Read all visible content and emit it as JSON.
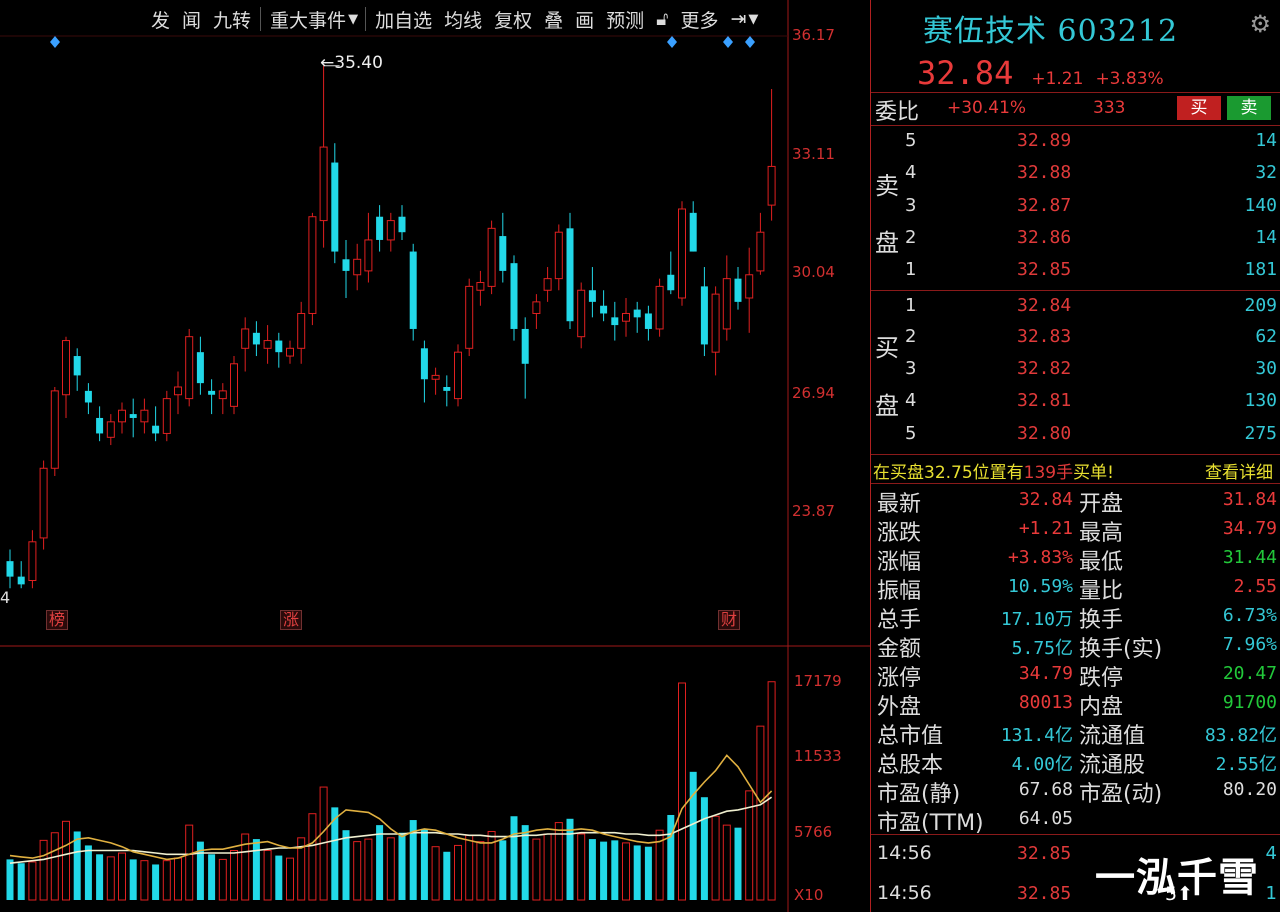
{
  "toolbar": {
    "items": [
      "发",
      "闻",
      "九转",
      "重大事件",
      "加自选",
      "均线",
      "复权",
      "叠",
      "画",
      "预测",
      "更多"
    ]
  },
  "chart_data": {
    "type": "candlestick",
    "price_axis": {
      "labels": [
        "36.17",
        "33.11",
        "30.04",
        "26.94",
        "23.87"
      ],
      "values": [
        36.17,
        33.11,
        30.04,
        26.94,
        23.87
      ]
    },
    "volume_axis": {
      "labels": [
        "17179",
        "11533",
        "5766"
      ],
      "values": [
        17179,
        11533,
        5766
      ],
      "multiplier_label": "X10"
    },
    "peak_label": "35.40",
    "low_label": "4",
    "event_tags": [
      "榜",
      "涨",
      "财"
    ],
    "colors": {
      "up": "#e02020",
      "down": "#22d8e8",
      "ma_short": "#e0b040",
      "ma_long": "#f0f0d0"
    },
    "candles": [
      {
        "o": 22.6,
        "h": 22.9,
        "l": 21.9,
        "c": 22.2
      },
      {
        "o": 22.2,
        "h": 22.6,
        "l": 21.9,
        "c": 22.0
      },
      {
        "o": 22.1,
        "h": 23.4,
        "l": 21.9,
        "c": 23.1
      },
      {
        "o": 23.2,
        "h": 25.2,
        "l": 22.9,
        "c": 25.0
      },
      {
        "o": 25.0,
        "h": 27.1,
        "l": 24.8,
        "c": 27.0
      },
      {
        "o": 26.9,
        "h": 28.4,
        "l": 26.3,
        "c": 28.3
      },
      {
        "o": 27.9,
        "h": 28.1,
        "l": 27.0,
        "c": 27.4
      },
      {
        "o": 27.0,
        "h": 27.2,
        "l": 26.4,
        "c": 26.7
      },
      {
        "o": 26.3,
        "h": 26.6,
        "l": 25.7,
        "c": 25.9
      },
      {
        "o": 25.8,
        "h": 26.4,
        "l": 25.6,
        "c": 26.2
      },
      {
        "o": 26.2,
        "h": 26.7,
        "l": 25.9,
        "c": 26.5
      },
      {
        "o": 26.4,
        "h": 26.8,
        "l": 25.8,
        "c": 26.3
      },
      {
        "o": 26.2,
        "h": 26.8,
        "l": 25.9,
        "c": 26.5
      },
      {
        "o": 26.1,
        "h": 26.6,
        "l": 25.7,
        "c": 25.9
      },
      {
        "o": 25.9,
        "h": 27.0,
        "l": 25.7,
        "c": 26.8
      },
      {
        "o": 26.9,
        "h": 27.5,
        "l": 26.4,
        "c": 27.1
      },
      {
        "o": 26.8,
        "h": 28.6,
        "l": 26.6,
        "c": 28.4
      },
      {
        "o": 28.0,
        "h": 28.4,
        "l": 26.9,
        "c": 27.2
      },
      {
        "o": 27.0,
        "h": 27.3,
        "l": 26.4,
        "c": 26.9
      },
      {
        "o": 26.8,
        "h": 27.2,
        "l": 26.4,
        "c": 27.0
      },
      {
        "o": 26.6,
        "h": 27.9,
        "l": 26.4,
        "c": 27.7
      },
      {
        "o": 28.1,
        "h": 28.9,
        "l": 27.5,
        "c": 28.6
      },
      {
        "o": 28.5,
        "h": 28.8,
        "l": 27.9,
        "c": 28.2
      },
      {
        "o": 28.1,
        "h": 28.7,
        "l": 27.7,
        "c": 28.3
      },
      {
        "o": 28.3,
        "h": 28.5,
        "l": 27.6,
        "c": 28.0
      },
      {
        "o": 27.9,
        "h": 28.3,
        "l": 27.7,
        "c": 28.1
      },
      {
        "o": 28.1,
        "h": 29.3,
        "l": 27.7,
        "c": 29.0
      },
      {
        "o": 29.0,
        "h": 31.6,
        "l": 28.7,
        "c": 31.5
      },
      {
        "o": 31.4,
        "h": 35.4,
        "l": 30.7,
        "c": 33.3
      },
      {
        "o": 32.9,
        "h": 33.4,
        "l": 30.3,
        "c": 30.6
      },
      {
        "o": 30.4,
        "h": 30.9,
        "l": 29.4,
        "c": 30.1
      },
      {
        "o": 30.0,
        "h": 30.8,
        "l": 29.6,
        "c": 30.4
      },
      {
        "o": 30.1,
        "h": 31.6,
        "l": 29.8,
        "c": 30.9
      },
      {
        "o": 31.5,
        "h": 31.8,
        "l": 30.6,
        "c": 30.9
      },
      {
        "o": 30.9,
        "h": 31.6,
        "l": 30.6,
        "c": 31.4
      },
      {
        "o": 31.5,
        "h": 31.8,
        "l": 30.9,
        "c": 31.1
      },
      {
        "o": 30.6,
        "h": 30.8,
        "l": 28.3,
        "c": 28.6
      },
      {
        "o": 28.1,
        "h": 28.3,
        "l": 26.7,
        "c": 27.3
      },
      {
        "o": 27.3,
        "h": 27.6,
        "l": 26.9,
        "c": 27.4
      },
      {
        "o": 27.1,
        "h": 27.4,
        "l": 26.6,
        "c": 27.0
      },
      {
        "o": 26.8,
        "h": 28.2,
        "l": 26.6,
        "c": 28.0
      },
      {
        "o": 28.1,
        "h": 29.9,
        "l": 27.9,
        "c": 29.7
      },
      {
        "o": 29.6,
        "h": 30.1,
        "l": 29.2,
        "c": 29.8
      },
      {
        "o": 29.7,
        "h": 31.4,
        "l": 29.5,
        "c": 31.2
      },
      {
        "o": 31.0,
        "h": 31.6,
        "l": 29.8,
        "c": 30.1
      },
      {
        "o": 30.3,
        "h": 30.5,
        "l": 28.3,
        "c": 28.6
      },
      {
        "o": 28.6,
        "h": 28.9,
        "l": 26.8,
        "c": 27.7
      },
      {
        "o": 29.0,
        "h": 29.5,
        "l": 28.6,
        "c": 29.3
      },
      {
        "o": 29.6,
        "h": 30.2,
        "l": 29.3,
        "c": 29.9
      },
      {
        "o": 29.9,
        "h": 31.3,
        "l": 29.6,
        "c": 31.1
      },
      {
        "o": 31.2,
        "h": 31.6,
        "l": 28.6,
        "c": 28.8
      },
      {
        "o": 28.4,
        "h": 29.8,
        "l": 28.1,
        "c": 29.6
      },
      {
        "o": 29.6,
        "h": 30.2,
        "l": 28.9,
        "c": 29.3
      },
      {
        "o": 29.2,
        "h": 29.6,
        "l": 28.8,
        "c": 29.0
      },
      {
        "o": 28.9,
        "h": 29.3,
        "l": 28.3,
        "c": 28.7
      },
      {
        "o": 28.8,
        "h": 29.4,
        "l": 28.4,
        "c": 29.0
      },
      {
        "o": 29.1,
        "h": 29.3,
        "l": 28.5,
        "c": 28.9
      },
      {
        "o": 29.0,
        "h": 29.2,
        "l": 28.3,
        "c": 28.6
      },
      {
        "o": 28.6,
        "h": 29.9,
        "l": 28.4,
        "c": 29.7
      },
      {
        "o": 30.0,
        "h": 30.6,
        "l": 29.5,
        "c": 29.6
      },
      {
        "o": 29.4,
        "h": 31.9,
        "l": 29.2,
        "c": 31.7
      },
      {
        "o": 31.6,
        "h": 31.9,
        "l": 30.6,
        "c": 30.6
      },
      {
        "o": 29.7,
        "h": 30.2,
        "l": 27.9,
        "c": 28.2
      },
      {
        "o": 28.0,
        "h": 29.7,
        "l": 27.4,
        "c": 29.5
      },
      {
        "o": 28.6,
        "h": 30.5,
        "l": 28.3,
        "c": 29.9
      },
      {
        "o": 29.9,
        "h": 30.2,
        "l": 29.1,
        "c": 29.3
      },
      {
        "o": 29.4,
        "h": 30.7,
        "l": 28.5,
        "c": 30.0
      },
      {
        "o": 30.1,
        "h": 31.6,
        "l": 30.0,
        "c": 31.1
      },
      {
        "o": 31.8,
        "h": 34.8,
        "l": 31.4,
        "c": 32.8
      }
    ],
    "volumes": [
      3200,
      2900,
      3000,
      4700,
      5300,
      6200,
      5400,
      4300,
      3600,
      3400,
      3700,
      3200,
      3100,
      2800,
      3100,
      3300,
      5900,
      4600,
      3600,
      3200,
      3900,
      5200,
      4800,
      3900,
      3500,
      3300,
      4900,
      6800,
      8900,
      7300,
      5500,
      4600,
      4800,
      5900,
      4900,
      5300,
      6300,
      5600,
      4200,
      3800,
      4300,
      5100,
      4600,
      5400,
      4700,
      6600,
      5900,
      4800,
      5200,
      6100,
      6400,
      5200,
      4800,
      4600,
      4700,
      4500,
      4300,
      4200,
      5500,
      6700,
      17100,
      10100,
      8100,
      6600,
      5900,
      5700,
      8600,
      13700,
      17200
    ],
    "ma_short": [
      3500,
      3400,
      3300,
      3500,
      3900,
      4300,
      4800,
      4900,
      4700,
      4500,
      4200,
      3800,
      3600,
      3400,
      3200,
      3300,
      3600,
      3900,
      4000,
      4000,
      4200,
      4400,
      4500,
      4600,
      4300,
      4100,
      4100,
      4500,
      5400,
      6400,
      7100,
      7000,
      6900,
      6400,
      5600,
      5000,
      5400,
      5600,
      5500,
      5200,
      4900,
      4700,
      4500,
      4500,
      4800,
      5200,
      5300,
      5500,
      5600,
      5500,
      5500,
      5600,
      5500,
      5200,
      5000,
      4800,
      4600,
      4500,
      4600,
      5000,
      7200,
      8300,
      9300,
      10200,
      11400,
      10500,
      9100,
      7700,
      8600
    ],
    "ma_long": [
      2900,
      3000,
      3100,
      3200,
      3400,
      3600,
      3800,
      3900,
      3900,
      3900,
      3900,
      3900,
      3800,
      3700,
      3600,
      3600,
      3600,
      3700,
      3700,
      3700,
      3700,
      3800,
      3900,
      4000,
      4100,
      4100,
      4200,
      4300,
      4500,
      4700,
      4900,
      5000,
      5100,
      5200,
      5200,
      5200,
      5300,
      5300,
      5300,
      5200,
      5200,
      5100,
      5100,
      5000,
      5000,
      5000,
      5100,
      5100,
      5200,
      5200,
      5200,
      5300,
      5300,
      5300,
      5300,
      5200,
      5200,
      5100,
      5100,
      5200,
      5600,
      6000,
      6400,
      6700,
      7000,
      7100,
      7300,
      7500,
      8100
    ]
  },
  "panel": {
    "title": "赛伍技术 603212",
    "price": "32.84",
    "change": "+1.21",
    "change_pct": "+3.83%",
    "wb_label": "委比",
    "wb_value": "+30.41%",
    "wb_diff": "333",
    "buy_label": "买",
    "sell_label": "卖",
    "sell_side": {
      "chars": [
        "卖",
        "盘"
      ]
    },
    "buy_side": {
      "chars": [
        "买",
        "盘"
      ]
    },
    "asks": [
      {
        "level": "5",
        "price": "32.89",
        "vol": "14"
      },
      {
        "level": "4",
        "price": "32.88",
        "vol": "32"
      },
      {
        "level": "3",
        "price": "32.87",
        "vol": "140"
      },
      {
        "level": "2",
        "price": "32.86",
        "vol": "14"
      },
      {
        "level": "1",
        "price": "32.85",
        "vol": "181"
      }
    ],
    "bids": [
      {
        "level": "1",
        "price": "32.84",
        "vol": "209"
      },
      {
        "level": "2",
        "price": "32.83",
        "vol": "62"
      },
      {
        "level": "3",
        "price": "32.82",
        "vol": "30"
      },
      {
        "level": "4",
        "price": "32.81",
        "vol": "130"
      },
      {
        "level": "5",
        "price": "32.80",
        "vol": "275"
      }
    ],
    "notice": {
      "prefix": "在买盘32.75位置有",
      "count": "139手",
      "suffix": "买单!",
      "link": "查看详细"
    },
    "quote_left": [
      {
        "label": "最新",
        "value": "32.84",
        "color": "red"
      },
      {
        "label": "涨跌",
        "value": "+1.21",
        "color": "red"
      },
      {
        "label": "涨幅",
        "value": "+3.83%",
        "color": "red"
      },
      {
        "label": "振幅",
        "value": "10.59%",
        "color": "cyan"
      },
      {
        "label": "总手",
        "value": "17.10万",
        "color": "cyan"
      },
      {
        "label": "金额",
        "value": "5.75亿",
        "color": "cyan"
      },
      {
        "label": "涨停",
        "value": "34.79",
        "color": "red"
      },
      {
        "label": "外盘",
        "value": "80013",
        "color": "red"
      },
      {
        "label": "总市值",
        "value": "131.4亿",
        "color": "cyan"
      },
      {
        "label": "总股本",
        "value": "4.00亿",
        "color": "cyan"
      },
      {
        "label": "市盈(静)",
        "value": "67.68",
        "color": "white"
      },
      {
        "label": "市盈(TTM)",
        "value": "64.05",
        "color": "white"
      }
    ],
    "quote_right": [
      {
        "label": "开盘",
        "value": "31.84",
        "color": "red"
      },
      {
        "label": "最高",
        "value": "34.79",
        "color": "red"
      },
      {
        "label": "最低",
        "value": "31.44",
        "color": "green"
      },
      {
        "label": "量比",
        "value": "2.55",
        "color": "red"
      },
      {
        "label": "换手",
        "value": "6.73%",
        "color": "cyan"
      },
      {
        "label": "换手(实)",
        "value": "7.96%",
        "color": "cyan"
      },
      {
        "label": "跌停",
        "value": "20.47",
        "color": "green"
      },
      {
        "label": "内盘",
        "value": "91700",
        "color": "green"
      },
      {
        "label": "流通值",
        "value": "83.82亿",
        "color": "cyan"
      },
      {
        "label": "流通股",
        "value": "2.55亿",
        "color": "cyan"
      },
      {
        "label": "市盈(动)",
        "value": "80.20",
        "color": "white"
      }
    ],
    "ticks": [
      {
        "time": "14:56",
        "price": "32.85",
        "vol": "4"
      },
      {
        "time": "14:56",
        "price": "32.85",
        "vol": "1"
      }
    ],
    "watermark": "一泓千雪",
    "watermark_sub": "5"
  }
}
